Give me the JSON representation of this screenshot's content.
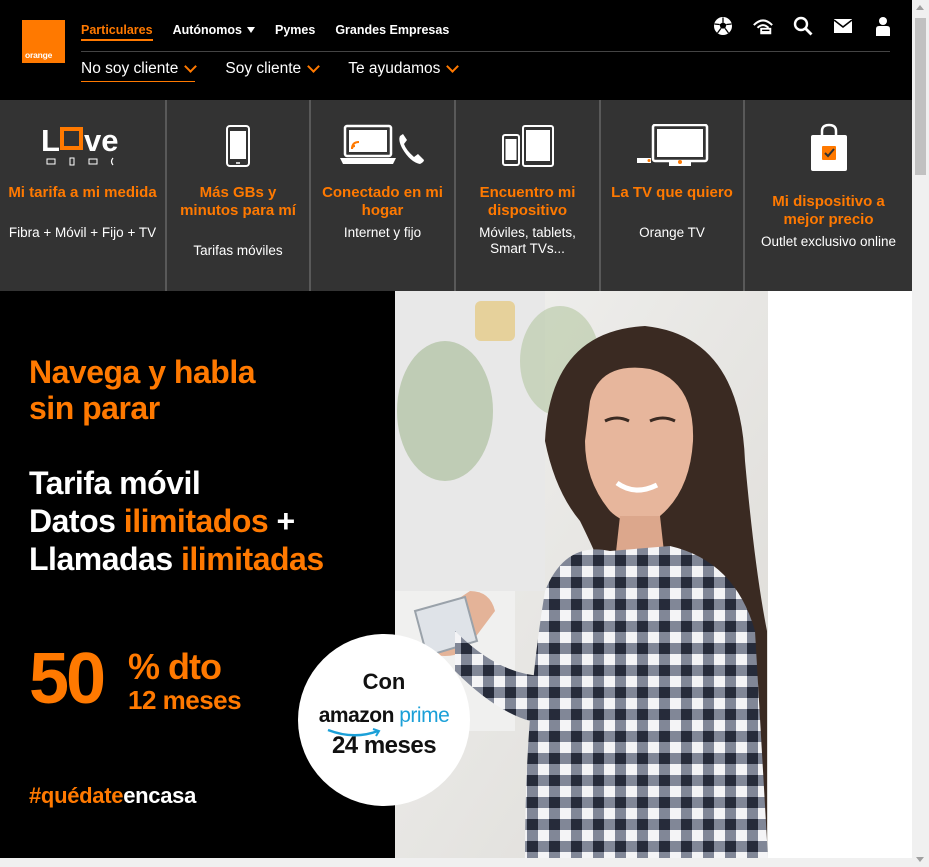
{
  "brand": {
    "logo_text": "orange",
    "color": "#ff7900"
  },
  "topnav": [
    {
      "label": "Particulares",
      "active": true
    },
    {
      "label": "Autónomos",
      "dropdown": true
    },
    {
      "label": "Pymes"
    },
    {
      "label": "Grandes Empresas"
    }
  ],
  "subnav": [
    {
      "label": "No soy cliente",
      "active": true
    },
    {
      "label": "Soy cliente"
    },
    {
      "label": "Te ayudamos"
    }
  ],
  "header_icons": [
    "football-icon",
    "wifi-device-icon",
    "search-icon",
    "mail-icon",
    "user-icon"
  ],
  "categories": [
    {
      "icon": "love-devices-icon",
      "icon_text": "Love",
      "title": "Mi tarifa a mi medida",
      "desc": "Fibra + Móvil + Fijo + TV"
    },
    {
      "icon": "smartphone-icon",
      "title": "Más GBs y minutos para mí",
      "desc": "Tarifas móviles"
    },
    {
      "icon": "laptop-phone-icon",
      "title": "Conectado en mi hogar",
      "desc": "Internet y fijo"
    },
    {
      "icon": "phone-tablet-icon",
      "title": "Encuentro mi dispositivo",
      "desc": "Móviles, tablets, Smart TVs..."
    },
    {
      "icon": "tv-icon",
      "title": "La TV que quiero",
      "desc": "Orange TV"
    },
    {
      "icon": "shopping-bag-icon",
      "title": "Mi dispositivo a mejor precio",
      "desc": "Outlet exclusivo online"
    }
  ],
  "hero": {
    "headline": [
      "Navega y habla",
      "sin parar"
    ],
    "line1": "Tarifa móvil",
    "line2_pre": "Datos ",
    "line2_hl": "ilimitados",
    "line2_post": " +",
    "line3_pre": "Llamadas ",
    "line3_hl": "ilimitadas",
    "discount_number": "50",
    "discount_pct": "% dto",
    "discount_months": "12 meses",
    "hashtag_hl": "#quédate",
    "hashtag_rest": "encasa",
    "badge": {
      "con": "Con",
      "amazon": "amazon",
      "prime": "prime",
      "months": "24 meses"
    }
  }
}
